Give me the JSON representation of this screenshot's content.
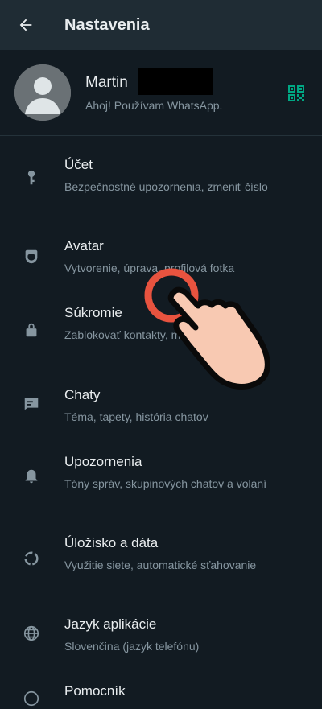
{
  "header": {
    "title": "Nastavenia",
    "back_icon": "arrow-left-icon"
  },
  "profile": {
    "name": "Martin",
    "status": "Ahoj! Používam WhatsApp.",
    "qr_icon": "qr-code-icon",
    "qr_color": "#00a884"
  },
  "settings": [
    {
      "icon": "key-icon",
      "label": "Účet",
      "sub": "Bezpečnostné upozornenia, zmeniť číslo"
    },
    {
      "icon": "avatar-icon",
      "label": "Avatar",
      "sub": "Vytvorenie, úprava, profilová fotka"
    },
    {
      "icon": "lock-icon",
      "label": "Súkromie",
      "sub": "Zablokovať kontakty, miznúce správy"
    },
    {
      "icon": "chat-icon",
      "label": "Chaty",
      "sub": "Téma, tapety, história chatov"
    },
    {
      "icon": "bell-icon",
      "label": "Upozornenia",
      "sub": "Tóny správ, skupinových chatov a volaní"
    },
    {
      "icon": "storage-icon",
      "label": "Úložisko a dáta",
      "sub": "Využitie siete, automatické sťahovanie"
    },
    {
      "icon": "globe-icon",
      "label": "Jazyk aplikácie",
      "sub": "Slovenčina (jazyk telefónu)"
    },
    {
      "icon": "help-icon",
      "label": "Pomocník",
      "sub": ""
    }
  ],
  "colors": {
    "background": "#121b22",
    "appbar": "#1f2c34",
    "text": "#e9edef",
    "subtext": "#8696a0",
    "accent": "#00a884"
  }
}
